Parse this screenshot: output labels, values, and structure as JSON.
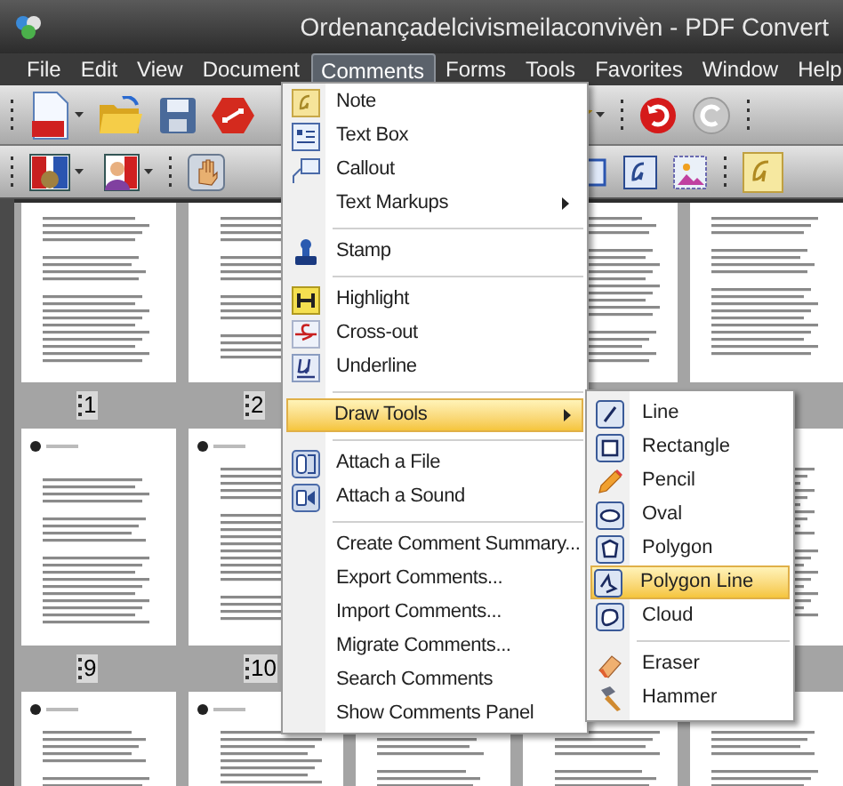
{
  "window": {
    "title": "Ordenançadelcivismeilaconvivèn - PDF Convert"
  },
  "menu_bar": [
    {
      "label": "File",
      "selected": false
    },
    {
      "label": "Edit",
      "selected": false
    },
    {
      "label": "View",
      "selected": false
    },
    {
      "label": "Document",
      "selected": false
    },
    {
      "label": "Comments",
      "selected": true
    },
    {
      "label": "Forms",
      "selected": false
    },
    {
      "label": "Tools",
      "selected": false
    },
    {
      "label": "Favorites",
      "selected": false
    },
    {
      "label": "Window",
      "selected": false
    },
    {
      "label": "Help",
      "selected": false
    }
  ],
  "page_labels": [
    [
      "1",
      "2"
    ],
    [
      "9",
      "10"
    ]
  ],
  "comments_menu": {
    "groups": [
      [
        {
          "label": "Note",
          "submenu": false,
          "selected": false
        },
        {
          "label": "Text Box",
          "submenu": false,
          "selected": false
        },
        {
          "label": "Callout",
          "submenu": false,
          "selected": false
        },
        {
          "label": "Text Markups",
          "submenu": true,
          "selected": false
        }
      ],
      [
        {
          "label": "Stamp",
          "submenu": false,
          "selected": false
        }
      ],
      [
        {
          "label": "Highlight",
          "submenu": false,
          "selected": false
        },
        {
          "label": "Cross-out",
          "submenu": false,
          "selected": false
        },
        {
          "label": "Underline",
          "submenu": false,
          "selected": false
        }
      ],
      [
        {
          "label": "Draw Tools",
          "submenu": true,
          "selected": true
        }
      ],
      [
        {
          "label": "Attach a File",
          "submenu": false,
          "selected": false
        },
        {
          "label": "Attach a Sound",
          "submenu": false,
          "selected": false
        }
      ],
      [
        {
          "label": "Create Comment Summary...",
          "submenu": false,
          "selected": false
        },
        {
          "label": "Export Comments...",
          "submenu": false,
          "selected": false
        },
        {
          "label": "Import Comments...",
          "submenu": false,
          "selected": false
        },
        {
          "label": "Migrate Comments...",
          "submenu": false,
          "selected": false
        },
        {
          "label": "Search Comments",
          "submenu": false,
          "selected": false
        },
        {
          "label": "Show Comments Panel",
          "submenu": false,
          "selected": false
        }
      ]
    ]
  },
  "draw_tools_menu": {
    "groups": [
      [
        {
          "label": "Line",
          "selected": false
        },
        {
          "label": "Rectangle",
          "selected": false
        },
        {
          "label": "Pencil",
          "selected": false
        },
        {
          "label": "Oval",
          "selected": false
        },
        {
          "label": "Polygon",
          "selected": false
        },
        {
          "label": "Polygon Line",
          "selected": true
        },
        {
          "label": "Cloud",
          "selected": false
        }
      ],
      [
        {
          "label": "Eraser",
          "selected": false
        },
        {
          "label": "Hammer",
          "selected": false
        }
      ]
    ]
  }
}
